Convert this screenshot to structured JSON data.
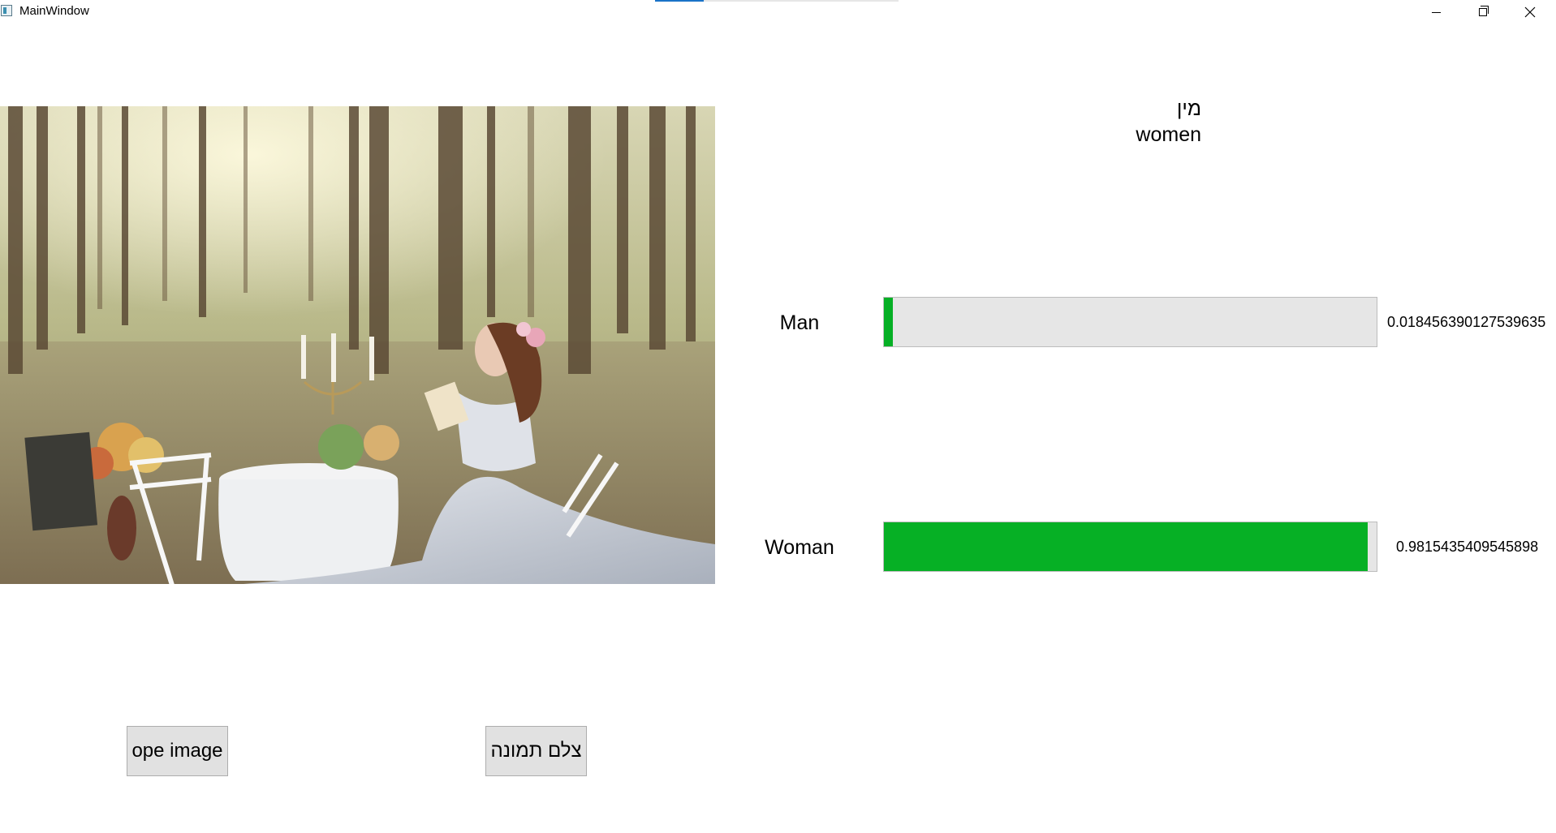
{
  "window": {
    "title": "MainWindow",
    "controls": {
      "minimize": "minimize-icon",
      "maximize": "restore-icon",
      "close": "close-icon"
    }
  },
  "result": {
    "heading": "מין",
    "value": "women"
  },
  "rows": [
    {
      "label": "Man",
      "probability": 0.018456390127539635,
      "probability_text": "0.018456390127539635"
    },
    {
      "label": "Woman",
      "probability": 0.9815435409545898,
      "probability_text": "0.9815435409545898"
    }
  ],
  "buttons": {
    "open_image": "ope image",
    "take_photo": "צלם תמונה"
  },
  "colors": {
    "progress_fill": "#06b025",
    "progress_track": "#e6e6e6",
    "button_bg": "#e1e1e1"
  }
}
